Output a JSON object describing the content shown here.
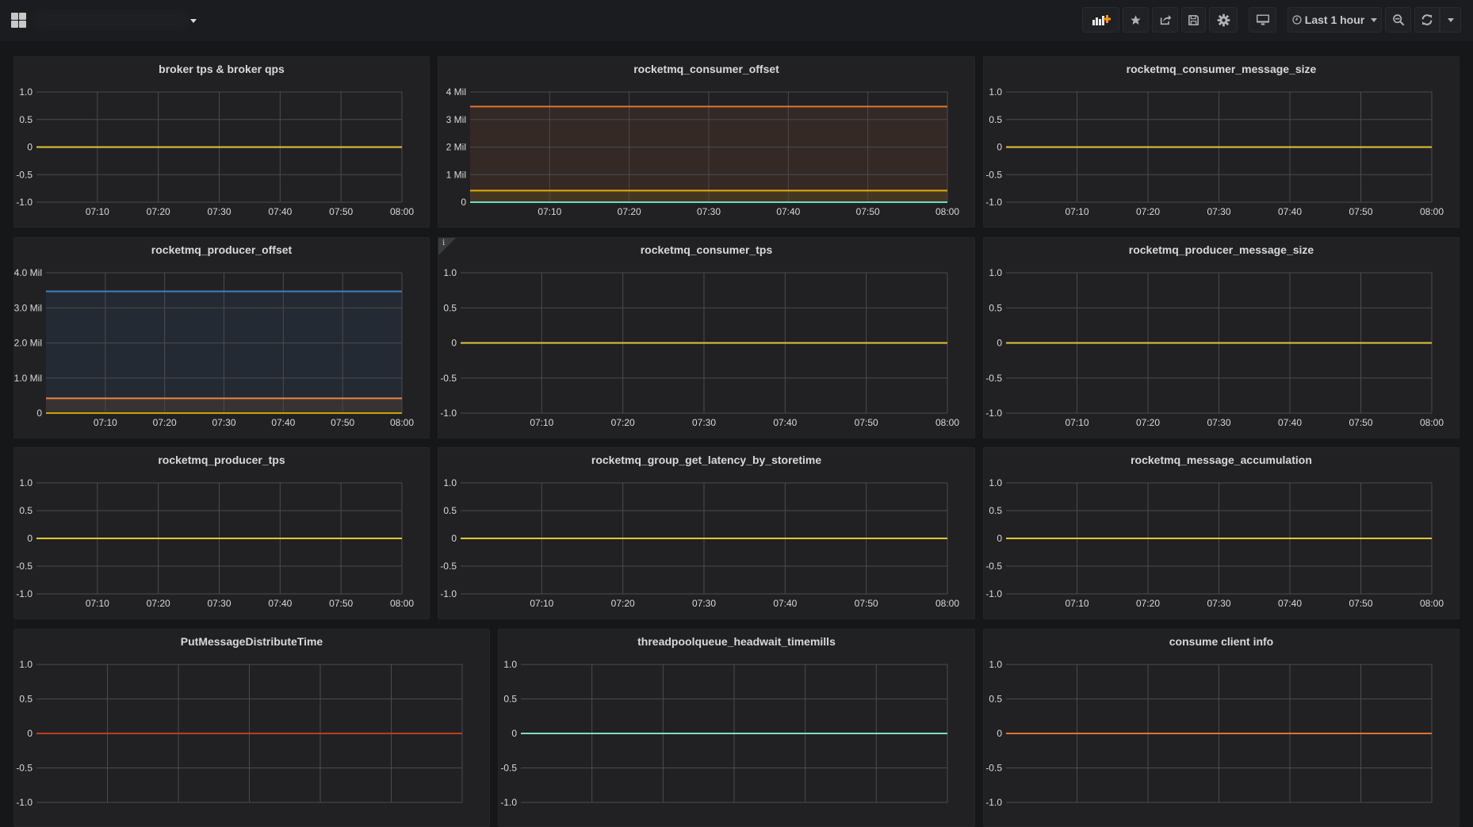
{
  "topbar": {
    "time_range": "Last 1 hour",
    "buttons": [
      "add-panel",
      "star",
      "share",
      "save",
      "settings",
      "tv-mode",
      "time-picker",
      "zoom-out",
      "refresh",
      "refresh-interval"
    ]
  },
  "panels": [
    {
      "title": "broker tps & broker qps",
      "ylim": [
        -1,
        1
      ],
      "yticks": [
        1,
        0.5,
        0,
        -0.5,
        -1
      ],
      "ytick_labels": [
        "1.0",
        "0.5",
        "0",
        "-0.5",
        "-1.0"
      ],
      "series": [
        {
          "values": 0,
          "color": "#e5c634",
          "fill": false
        }
      ]
    },
    {
      "title": "rocketmq_consumer_offset",
      "ylim": [
        0,
        4000000
      ],
      "yticks": [
        4000000,
        3000000,
        2000000,
        1000000,
        0
      ],
      "ytick_labels": [
        "4 Mil",
        "3 Mil",
        "2 Mil",
        "1 Mil",
        "0"
      ],
      "series": [
        {
          "values": 3470000,
          "color": "#e0752d",
          "fill": true
        },
        {
          "values": 420000,
          "color": "#e5ac0e",
          "fill": true
        },
        {
          "values": 0,
          "color": "#70dbc3",
          "fill": true
        }
      ]
    },
    {
      "title": "rocketmq_consumer_message_size",
      "ylim": [
        -1,
        1
      ],
      "yticks": [
        1,
        0.5,
        0,
        -0.5,
        -1
      ],
      "ytick_labels": [
        "1.0",
        "0.5",
        "0",
        "-0.5",
        "-1.0"
      ],
      "series": [
        {
          "values": 0,
          "color": "#e5c634",
          "fill": false
        }
      ]
    },
    {
      "title": "rocketmq_producer_offset",
      "ylim": [
        0,
        4000000
      ],
      "yticks": [
        4000000,
        3000000,
        2000000,
        1000000,
        0
      ],
      "ytick_labels": [
        "4.0 Mil",
        "3.0 Mil",
        "2.0 Mil",
        "1.0 Mil",
        "0"
      ],
      "series": [
        {
          "values": 3470000,
          "color": "#447ebc",
          "fill": true
        },
        {
          "values": 420000,
          "color": "#ef843c",
          "fill": true
        },
        {
          "values": 0,
          "color": "#cca300",
          "fill": true
        }
      ]
    },
    {
      "title": "rocketmq_consumer_tps",
      "info": "i",
      "ylim": [
        -1,
        1
      ],
      "yticks": [
        1,
        0.5,
        0,
        -0.5,
        -1
      ],
      "ytick_labels": [
        "1.0",
        "0.5",
        "0",
        "-0.5",
        "-1.0"
      ],
      "series": [
        {
          "values": 0,
          "color": "#e5c634",
          "fill": false
        }
      ]
    },
    {
      "title": "rocketmq_producer_message_size",
      "ylim": [
        -1,
        1
      ],
      "yticks": [
        1,
        0.5,
        0,
        -0.5,
        -1
      ],
      "ytick_labels": [
        "1.0",
        "0.5",
        "0",
        "-0.5",
        "-1.0"
      ],
      "series": [
        {
          "values": 0,
          "color": "#e5c634",
          "fill": false
        }
      ]
    },
    {
      "title": "rocketmq_producer_tps",
      "ylim": [
        -1,
        1
      ],
      "yticks": [
        1,
        0.5,
        0,
        -0.5,
        -1
      ],
      "ytick_labels": [
        "1.0",
        "0.5",
        "0",
        "-0.5",
        "-1.0"
      ],
      "series": [
        {
          "values": 0,
          "color": "#e5c634",
          "fill": false
        }
      ]
    },
    {
      "title": "rocketmq_group_get_latency_by_storetime",
      "ylim": [
        -1,
        1
      ],
      "yticks": [
        1,
        0.5,
        0,
        -0.5,
        -1
      ],
      "ytick_labels": [
        "1.0",
        "0.5",
        "0",
        "-0.5",
        "-1.0"
      ],
      "series": [
        {
          "values": 0,
          "color": "#e5c634",
          "fill": false
        }
      ]
    },
    {
      "title": "rocketmq_message_accumulation",
      "ylim": [
        -1,
        1
      ],
      "yticks": [
        1,
        0.5,
        0,
        -0.5,
        -1
      ],
      "ytick_labels": [
        "1.0",
        "0.5",
        "0",
        "-0.5",
        "-1.0"
      ],
      "series": [
        {
          "values": 0,
          "color": "#e5c634",
          "fill": false
        }
      ]
    },
    {
      "title": "PutMessageDistributeTime",
      "ylim": [
        -1,
        1
      ],
      "yticks": [
        1,
        0.5,
        0,
        -0.5,
        -1
      ],
      "ytick_labels": [
        "1.0",
        "0.5",
        "0",
        "-0.5",
        "-1.0"
      ],
      "series": [
        {
          "values": 0,
          "color": "#bf3b1e",
          "fill": false
        }
      ]
    },
    {
      "title": "threadpoolqueue_headwait_timemills",
      "ylim": [
        -1,
        1
      ],
      "yticks": [
        1,
        0.5,
        0,
        -0.5,
        -1
      ],
      "ytick_labels": [
        "1.0",
        "0.5",
        "0",
        "-0.5",
        "-1.0"
      ],
      "series": [
        {
          "values": 0,
          "color": "#7eddc0",
          "fill": false
        }
      ]
    },
    {
      "title": "consume client info",
      "ylim": [
        -1,
        1
      ],
      "yticks": [
        1,
        0.5,
        0,
        -0.5,
        -1
      ],
      "ytick_labels": [
        "1.0",
        "0.5",
        "0",
        "-0.5",
        "-1.0"
      ],
      "series": [
        {
          "values": 0,
          "color": "#e0752d",
          "fill": false
        }
      ]
    }
  ],
  "x_axis": {
    "xlim": [
      "07:00",
      "08:00"
    ],
    "ticks": [
      "07:10",
      "07:20",
      "07:30",
      "07:40",
      "07:50",
      "08:00"
    ]
  }
}
